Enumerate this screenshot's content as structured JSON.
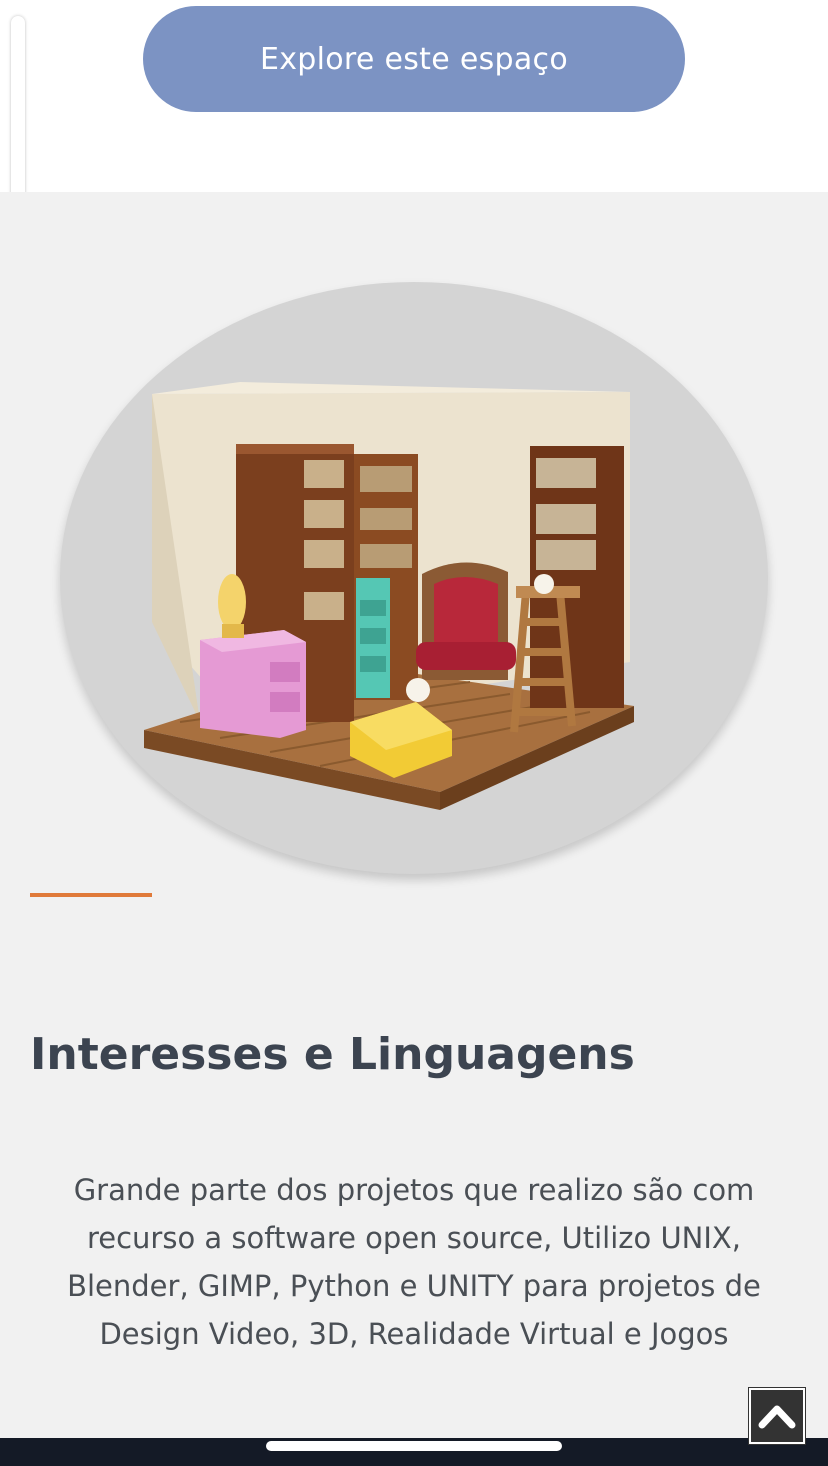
{
  "hero": {
    "explore_button_label": "Explore este espaço"
  },
  "section": {
    "image_alt": "Sala 3D low poly com estantes de livros, poltrona e mesa",
    "heading": "Interesses e Linguagens",
    "description": "Grande parte dos projetos que realizo são com recurso a software open source, Utilizo UNIX, Blender, GIMP, Python e UNITY para projetos de Design Video, 3D, Realidade Virtual e Jogos"
  },
  "controls": {
    "back_to_top_icon": "chevron-up-icon"
  },
  "colors": {
    "button": "#7c93c3",
    "accent": "#e07a3a",
    "heading": "#3c4450",
    "background": "#f1f1f1"
  }
}
